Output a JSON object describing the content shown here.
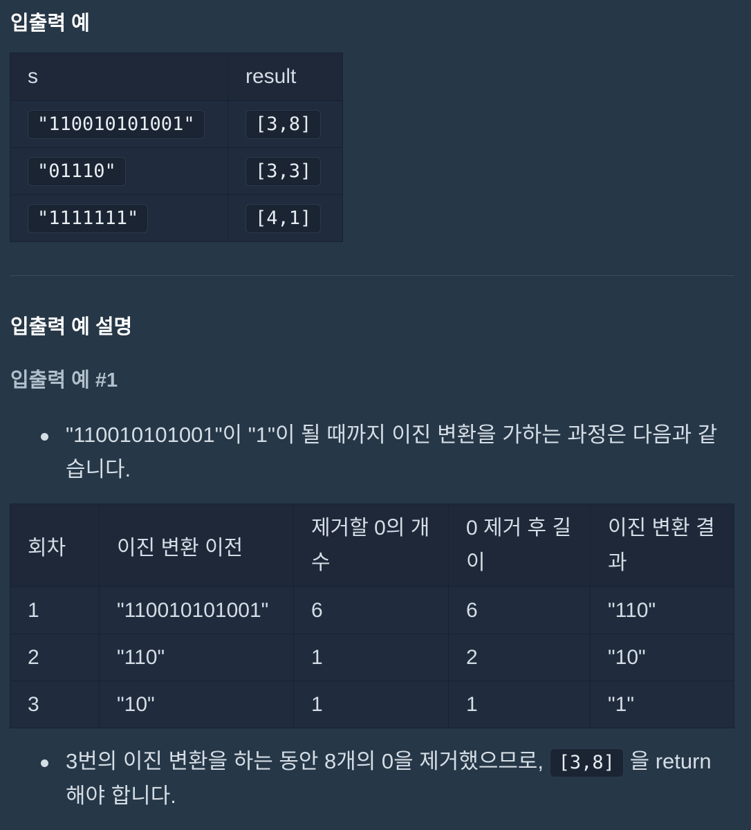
{
  "section1": {
    "title": "입출력 예",
    "table": {
      "headers": [
        "s",
        "result"
      ],
      "rows": [
        {
          "s": "\"110010101001\"",
          "result": "[3,8]"
        },
        {
          "s": "\"01110\"",
          "result": "[3,3]"
        },
        {
          "s": "\"1111111\"",
          "result": "[4,1]"
        }
      ]
    }
  },
  "section2": {
    "title": "입출력 예 설명",
    "example_title": "입출력 예 #1",
    "bullet1": "\"110010101001\"이 \"1\"이 될 때까지 이진 변환을 가하는 과정은 다음과 같습니다.",
    "table": {
      "headers": [
        "회차",
        "이진 변환 이전",
        "제거할 0의 개수",
        "0 제거 후 길이",
        "이진 변환 결과"
      ],
      "rows": [
        [
          "1",
          "\"110010101001\"",
          "6",
          "6",
          "\"110\""
        ],
        [
          "2",
          "\"110\"",
          "1",
          "2",
          "\"10\""
        ],
        [
          "3",
          "\"10\"",
          "1",
          "1",
          "\"1\""
        ]
      ]
    },
    "bullet2": {
      "before": "3번의 이진 변환을 하는 동안 8개의 0을 제거했으므로,",
      "code": "[3,8]",
      "after": "을 return 해야 합니다."
    }
  }
}
